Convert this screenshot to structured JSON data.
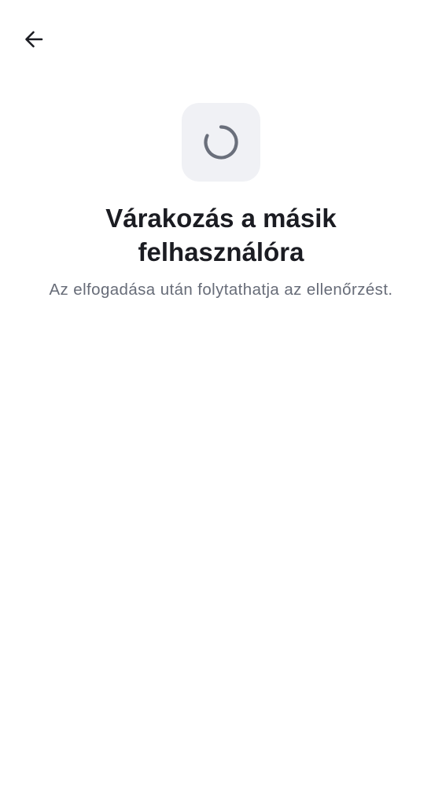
{
  "header": {
    "back_icon": "arrow-left-icon"
  },
  "status": {
    "icon": "loading-spinner-icon",
    "title_line_1": "Várakozás a másik",
    "title_line_2": "felhasználóra",
    "subtitle": "Az elfogadása után folytathatja az ellenőrzést."
  },
  "colors": {
    "text_primary": "#1b1c22",
    "text_secondary": "#676c78",
    "tile_background": "#f0f1f5",
    "spinner": "#6a6f7b",
    "page_background": "#ffffff"
  }
}
